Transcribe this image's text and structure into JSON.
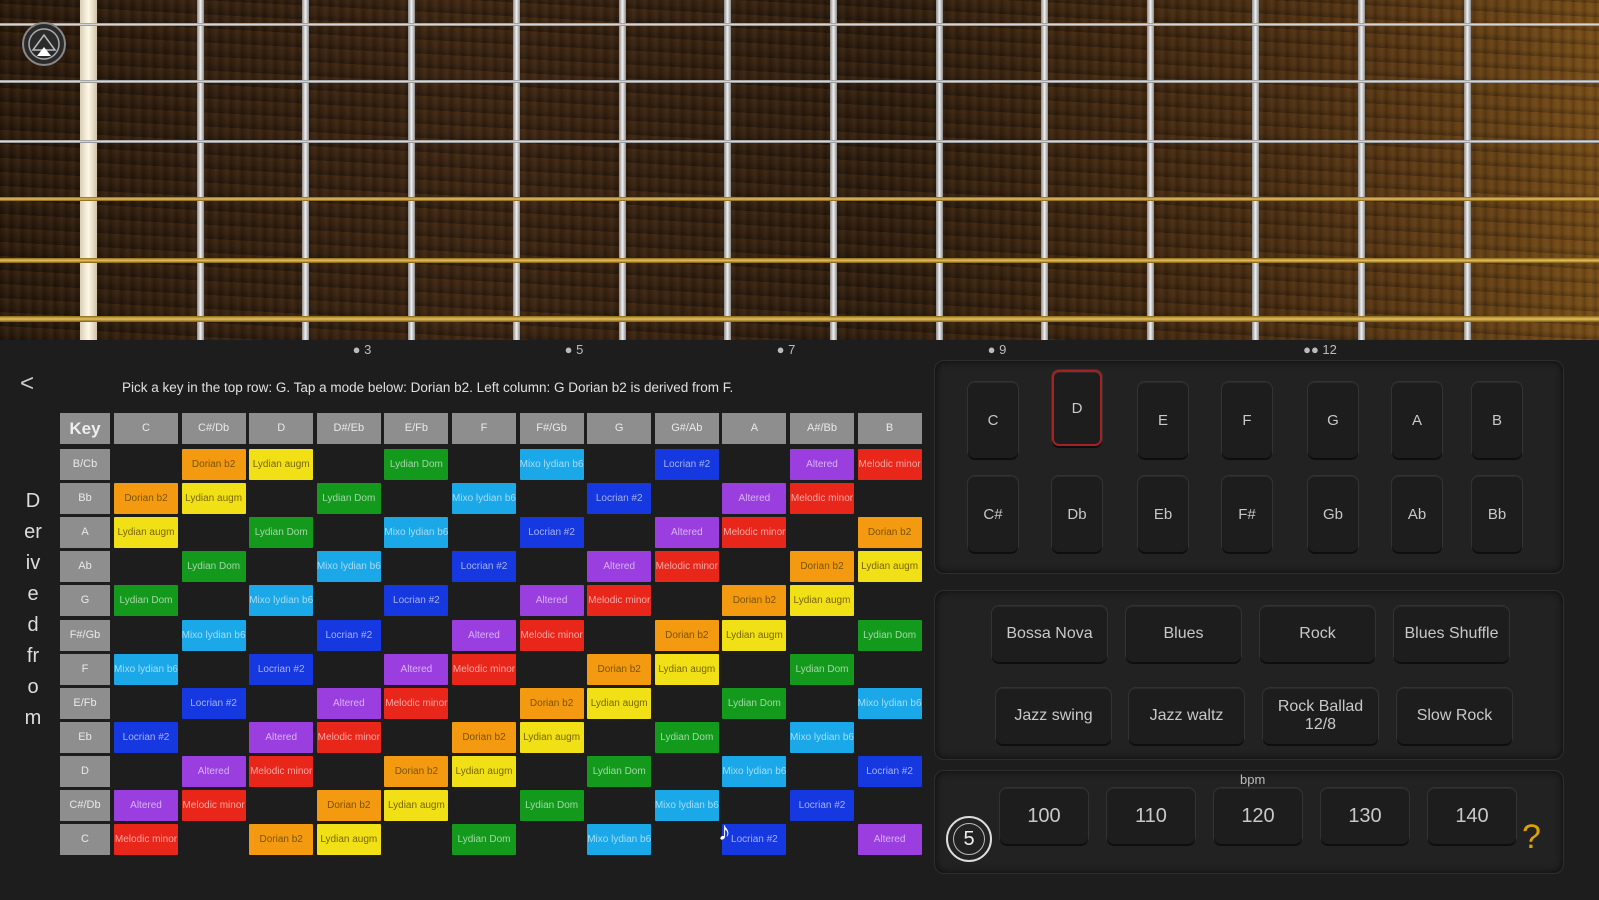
{
  "fretboard": {
    "up_icon": "eject-up-icon"
  },
  "fret_markers": [
    "● 3",
    "● 5",
    "● 7",
    "● 9",
    "●● 12"
  ],
  "instructions": "Pick a key in the top row: G. Tap a mode below: Dorian b2. Left column: G Dorian b2 is derived from F.",
  "back_label": "<",
  "derived_label": "Derived from",
  "grid": {
    "corner_label": "Key",
    "columns": [
      "C",
      "C#/Db",
      "D",
      "D#/Eb",
      "E/Fb",
      "F",
      "F#/Gb",
      "G",
      "G#/Ab",
      "A",
      "A#/Bb",
      "B"
    ],
    "rows": [
      {
        "label": "B/Cb",
        "cells": [
          null,
          "Dorian b2",
          "Lydian augm",
          null,
          "Lydian Dom",
          null,
          "Mixo lydian b6",
          null,
          "Locrian #2",
          null,
          "Altered",
          "Melodic minor"
        ]
      },
      {
        "label": "Bb",
        "cells": [
          "Dorian b2",
          "Lydian augm",
          null,
          "Lydian Dom",
          null,
          "Mixo lydian b6",
          null,
          "Locrian #2",
          null,
          "Altered",
          "Melodic minor",
          null
        ]
      },
      {
        "label": "A",
        "cells": [
          "Lydian augm",
          null,
          "Lydian Dom",
          null,
          "Mixo lydian b6",
          null,
          "Locrian #2",
          null,
          "Altered",
          "Melodic minor",
          null,
          "Dorian b2"
        ]
      },
      {
        "label": "Ab",
        "cells": [
          null,
          "Lydian Dom",
          null,
          "Mixo lydian b6",
          null,
          "Locrian #2",
          null,
          "Altered",
          "Melodic minor",
          null,
          "Dorian b2",
          "Lydian augm"
        ]
      },
      {
        "label": "G",
        "cells": [
          "Lydian Dom",
          null,
          "Mixo lydian b6",
          null,
          "Locrian #2",
          null,
          "Altered",
          "Melodic minor",
          null,
          "Dorian b2",
          "Lydian augm",
          null
        ]
      },
      {
        "label": "F#/Gb",
        "cells": [
          null,
          "Mixo lydian b6",
          null,
          "Locrian #2",
          null,
          "Altered",
          "Melodic minor",
          null,
          "Dorian b2",
          "Lydian augm",
          null,
          "Lydian Dom"
        ]
      },
      {
        "label": "F",
        "cells": [
          "Mixo lydian b6",
          null,
          "Locrian #2",
          null,
          "Altered",
          "Melodic minor",
          null,
          "Dorian b2",
          "Lydian augm",
          null,
          "Lydian Dom",
          null
        ]
      },
      {
        "label": "E/Fb",
        "cells": [
          null,
          "Locrian #2",
          null,
          "Altered",
          "Melodic minor",
          null,
          "Dorian b2",
          "Lydian augm",
          null,
          "Lydian Dom",
          null,
          "Mixo lydian b6"
        ]
      },
      {
        "label": "Eb",
        "cells": [
          "Locrian #2",
          null,
          "Altered",
          "Melodic minor",
          null,
          "Dorian b2",
          "Lydian augm",
          null,
          "Lydian Dom",
          null,
          "Mixo lydian b6",
          null
        ]
      },
      {
        "label": "D",
        "cells": [
          null,
          "Altered",
          "Melodic minor",
          null,
          "Dorian b2",
          "Lydian augm",
          null,
          "Lydian Dom",
          null,
          "Mixo lydian b6",
          null,
          "Locrian #2"
        ]
      },
      {
        "label": "C#/Db",
        "cells": [
          "Altered",
          "Melodic minor",
          null,
          "Dorian b2",
          "Lydian augm",
          null,
          "Lydian Dom",
          null,
          "Mixo lydian b6",
          null,
          "Locrian #2",
          null
        ]
      },
      {
        "label": "C",
        "cells": [
          "Melodic minor",
          null,
          "Dorian b2",
          "Lydian augm",
          null,
          "Lydian Dom",
          null,
          "Mixo lydian b6",
          null,
          "Locrian #2",
          null,
          "Altered"
        ]
      }
    ],
    "mode_colors": {
      "Dorian b2": "#f39a10",
      "Lydian augm": "#f0e015",
      "Lydian Dom": "#139a1c",
      "Mixo lydian b6": "#1aa8e8",
      "Locrian #2": "#1638e0",
      "Altered": "#9a3ee0",
      "Melodic minor": "#e8261a"
    }
  },
  "keys": {
    "row1": [
      "C",
      "D",
      "E",
      "F",
      "G",
      "A",
      "B"
    ],
    "row2": [
      "C#",
      "Db",
      "Eb",
      "F#",
      "Gb",
      "Ab",
      "Bb"
    ],
    "selected": "D"
  },
  "styles": {
    "row1": [
      "Bossa Nova",
      "Blues",
      "Rock",
      "Blues Shuffle"
    ],
    "row2": [
      "Jazz swing",
      "Jazz waltz",
      "Rock Ballad 12/8",
      "Slow Rock"
    ]
  },
  "tempo": {
    "label": "bpm",
    "values": [
      "100",
      "110",
      "120",
      "130",
      "140"
    ],
    "count_in": "5"
  },
  "help_label": "?",
  "note_icon": "music-note-icon"
}
